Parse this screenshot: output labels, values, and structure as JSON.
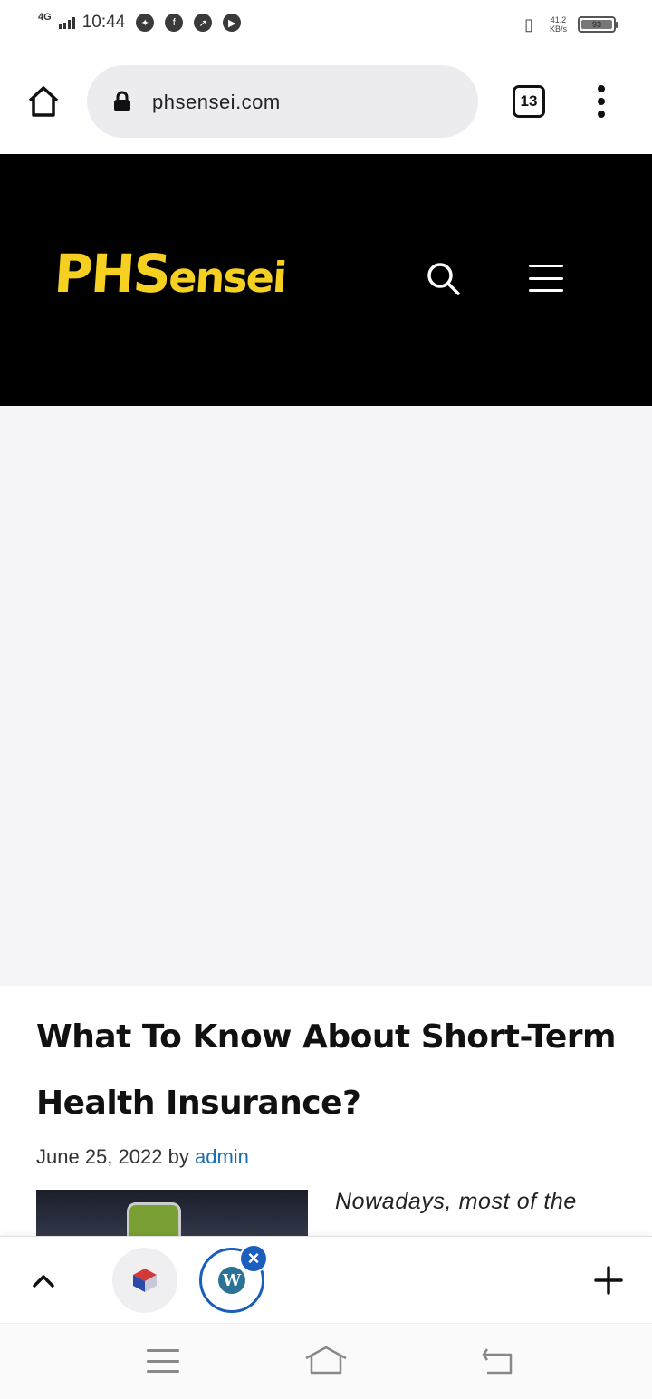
{
  "status_bar": {
    "network": "4G",
    "time": "10:44",
    "speed_value": "41.2",
    "speed_unit": "KB/s",
    "battery": "93",
    "notification_icons": [
      "messenger-icon",
      "facebook-icon",
      "compass-icon",
      "youtube-icon"
    ]
  },
  "browser": {
    "url": "phsensei.com",
    "tab_count": "13"
  },
  "site": {
    "logo_main": "PHS",
    "logo_tail": "ensei",
    "brand_color": "#f5d020"
  },
  "article": {
    "title": "What To Know About Short-Term Health Insurance?",
    "date": "June 25, 2022",
    "by": "by",
    "author": "admin",
    "excerpt": "Nowadays, most of the"
  },
  "tab_strip": {
    "close_symbol": "×",
    "wp_letter": "W"
  }
}
